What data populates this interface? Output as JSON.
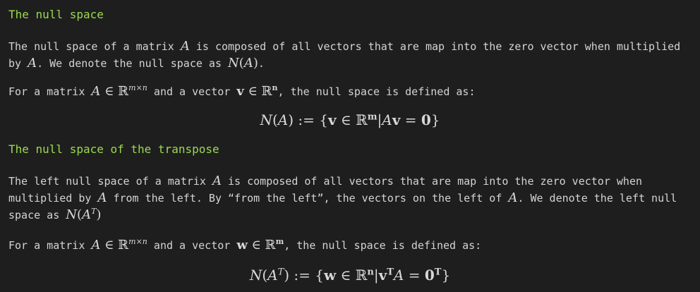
{
  "sections": [
    {
      "heading": "The null space",
      "intro_a": "The null space of a matrix ",
      "intro_b": " is composed of all vectors that are map into the zero vector when multiplied by ",
      "intro_c": ". We denote the null space as ",
      "intro_d": ".",
      "def_a": "For a matrix ",
      "def_b": " and a vector ",
      "def_c": ", the null space is defined as:"
    },
    {
      "heading": "The null space of the transpose",
      "intro_a": "The left null space of a matrix ",
      "intro_b": " is composed of all vectors that are map into the zero vector when multiplied by ",
      "intro_c": " from the left. By “from the left”, the vectors on the left of ",
      "intro_d": ". We denote the left null space as ",
      "def_a": "For a matrix ",
      "def_b": " and a vector ",
      "def_c": ", the null space is defined as:"
    }
  ],
  "math": {
    "A": "A",
    "NA": "N(A)",
    "in": " ∈ ℝ",
    "mxn": "m×n",
    "v": "v",
    "w": "w",
    "n_bold": "n",
    "m_bold": "m",
    "eq1": "N(A) := {v ∈ ℝᵐ|Av = 0}",
    "eq2": "N(Aᵀ) := {w ∈ ℝⁿ|vᵀA = 0ᵀ}"
  }
}
